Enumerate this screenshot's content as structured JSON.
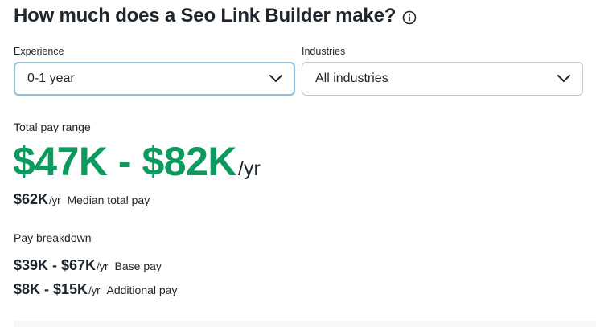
{
  "header": {
    "title": "How much does a Seo Link Builder make?",
    "info_icon": "info-circle-icon"
  },
  "filters": {
    "experience": {
      "label": "Experience",
      "value": "0-1 year",
      "icon": "chevron-down-icon"
    },
    "industries": {
      "label": "Industries",
      "value": "All industries",
      "icon": "chevron-down-icon"
    }
  },
  "total_pay": {
    "label": "Total pay range",
    "range": "$47K - $82K",
    "unit": "/yr",
    "median_value": "$62K",
    "median_unit": "/yr",
    "median_label": "Median total pay"
  },
  "breakdown": {
    "label": "Pay breakdown",
    "items": [
      {
        "value": "$39K - $67K",
        "unit": "/yr",
        "label": "Base pay"
      },
      {
        "value": "$8K - $15K",
        "unit": "/yr",
        "label": "Additional pay"
      }
    ]
  },
  "colors": {
    "accent_green": "#0c9a5f",
    "text": "#20262e",
    "focus_border": "#8fc1dc"
  }
}
